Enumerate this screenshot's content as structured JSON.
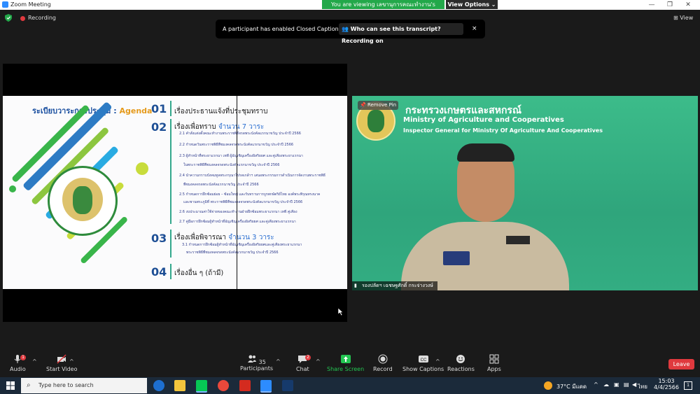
{
  "window": {
    "title": "Zoom Meeting",
    "viewing_banner": "You are viewing เลขานุการคณะทำงาน's screen",
    "view_options": "View Options"
  },
  "topbar": {
    "recording": "Recording",
    "view": "View"
  },
  "caption_notice": {
    "text": "A participant has enabled Closed Captioning",
    "who_link": "Who can see this transcript? Recording on",
    "close": "×"
  },
  "slide": {
    "title_th": "ระเบียบวาระการประชุม",
    "title_sep": " : ",
    "title_agenda": "Agenda",
    "items": [
      {
        "num": "01",
        "heading": "เรื่องประธานแจ้งที่ประชุมทราบ",
        "accent": ""
      },
      {
        "num": "02",
        "heading": "เรื่องเพื่อทราบ",
        "accent": "จำนวน 7 วาระ"
      },
      {
        "num": "03",
        "heading": "เรื่องเพื่อพิจารณา",
        "accent": "จำนวน 3 วาระ"
      },
      {
        "num": "04",
        "heading": "เรื่องอื่น ๆ (ถ้ามี)",
        "accent": ""
      }
    ],
    "subitems_02": [
      "2.1 คำสั่งแต่งตั้งคณะทำงานพระราชพิธีจรดพระนังคัลแรกนาขวัญ ประจำปี 2566",
      "2.2 กำหนดวันพระราชพิธีพืชมงคลจรดพระนังคัลแรกนาขวัญ ประจำปี 2566",
      "2.3 ผู้ทำหน้าที่พระยาแรกนา เทพี ผู้อัญเชิญเครื่องอิสริยยศ และคู่เคียงพระยาแรกนา",
      "ในพระราชพิธีพืชมงคลจรดพระนังคัลแรกนาขวัญ ประจำปี 2566",
      "2.4 นำความกราบบังคมทูลพระกรุณาโปรดเกล้าฯ เสนอพระกรรมการดำเนินการจัดงานพระราชพิธี",
      "พืชมงคลจรดพระนังคัลแรกนาขวัญ ประจำปี 2566",
      "2.5 กำหนดการฝึกซ้อมย่อย – ซ้อมใหญ่ และรับทราบการบูรพกษัตริย์ไทย องค์พระพิรุณทรงนาค",
      "และพานพระภูมิที่ พระราชพิธีพืชมงคลจรดพระนังคัลแรกนาขวัญ ประจำปี 2566",
      "2.6 งบประมาณค่าใช้จ่ายของคณะทำงานฝ่ายฝึกซ้อมพระยาแรกนา เทพี คู่เคียง",
      "2.7 คู่มือการฝึกซ้อมผู้ทำหน้าที่อัญเชิญเครื่องอิสริยยศ และคู่เคียงพระยาแรกนา"
    ],
    "subitems_03": [
      "3.1 กำหนดการฝึกซ้อมผู้ทำหน้าที่อัญเชิญเครื่องอิสริยยศและคู่เคียงพระยาแรกนา",
      "พระราชพิธีพืชมงคลจรดพระนังคัลแรกนาขวัญ ประจำปี 2566"
    ]
  },
  "video": {
    "remove_pin": "Remove Pin",
    "ministry_th": "กระทรวงเกษตรและสหกรณ์",
    "ministry_en": "Ministry of Agriculture and Cooperatives",
    "inspector_en": "Inspector General for Ministry Of Agriculture And Cooperatives",
    "name_tag": "รองปลัดฯ เฉชษฐศักดิ์ กระจ่างวงษ์"
  },
  "toolbar": {
    "audio": "Audio",
    "audio_badge": "1",
    "start_video": "Start Video",
    "participants": "Participants",
    "participants_count": "35",
    "chat": "Chat",
    "chat_badge": "2",
    "share_screen": "Share Screen",
    "record": "Record",
    "show_captions": "Show Captions",
    "reactions": "Reactions",
    "apps": "Apps",
    "leave": "Leave"
  },
  "taskbar": {
    "search_placeholder": "Type here to search",
    "weather": "37°C มีแดด",
    "lang": "ไทย",
    "time": "15:03",
    "date": "4/4/2566",
    "notif_count": "1"
  },
  "colors": {
    "zoom_blue": "#2d8cff",
    "green_banner": "#23a84a",
    "leave_red": "#e0393e",
    "video_green": "#3cbc8a"
  }
}
